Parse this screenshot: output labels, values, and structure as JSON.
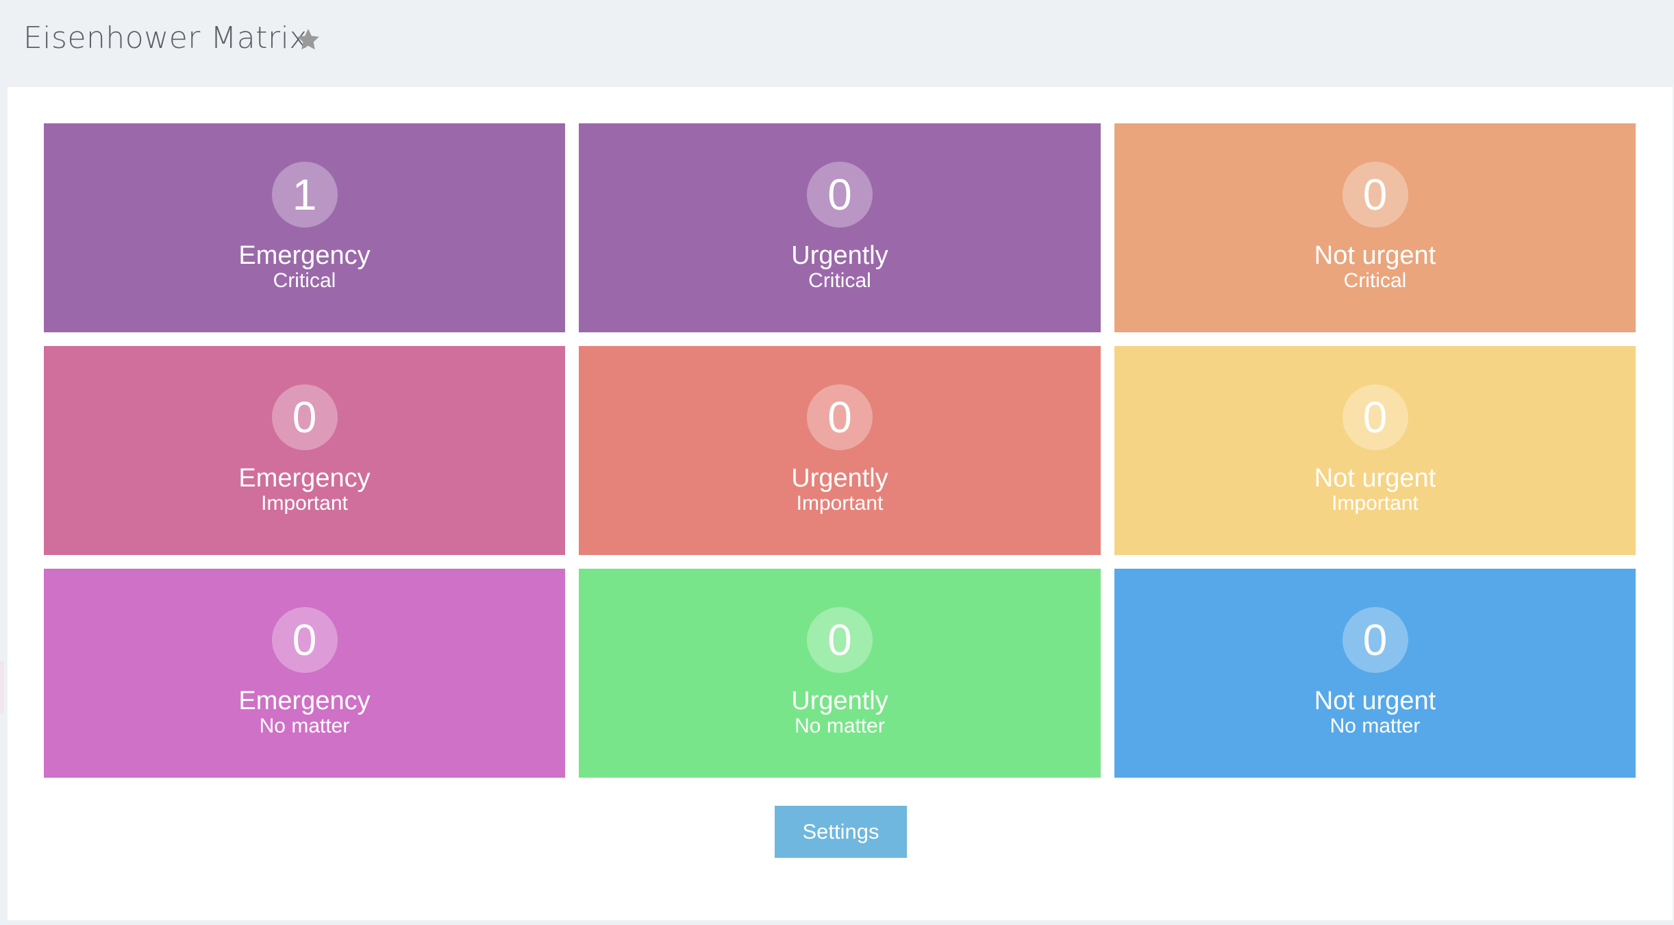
{
  "header": {
    "title": "Eisenhower Matrix",
    "favorite_icon": "star-icon"
  },
  "matrix": {
    "rows": [
      {
        "importance": "Critical",
        "cells": [
          {
            "count": "1",
            "title": "Emergency",
            "subtitle": "Critical",
            "color": "#9b69aa"
          },
          {
            "count": "0",
            "title": "Urgently",
            "subtitle": "Critical",
            "color": "#9b69aa"
          },
          {
            "count": "0",
            "title": "Not urgent",
            "subtitle": "Critical",
            "color": "#eaa57d"
          }
        ]
      },
      {
        "importance": "Important",
        "cells": [
          {
            "count": "0",
            "title": "Emergency",
            "subtitle": "Important",
            "color": "#d06f9b"
          },
          {
            "count": "0",
            "title": "Urgently",
            "subtitle": "Important",
            "color": "#e5837b"
          },
          {
            "count": "0",
            "title": "Not urgent",
            "subtitle": "Important",
            "color": "#f6d485"
          }
        ]
      },
      {
        "importance": "No matter",
        "cells": [
          {
            "count": "0",
            "title": "Emergency",
            "subtitle": "No matter",
            "color": "#cf71c6"
          },
          {
            "count": "0",
            "title": "Urgently",
            "subtitle": "No matter",
            "color": "#79e58a"
          },
          {
            "count": "0",
            "title": "Not urgent",
            "subtitle": "No matter",
            "color": "#57a8e9"
          }
        ]
      }
    ]
  },
  "actions": {
    "settings_label": "Settings"
  },
  "colors": {
    "header_background": "#eef1f4",
    "panel_background": "#ffffff",
    "settings_button": "#6fb7de",
    "title_text": "#5a5f66",
    "star": "#9a9a9a"
  }
}
